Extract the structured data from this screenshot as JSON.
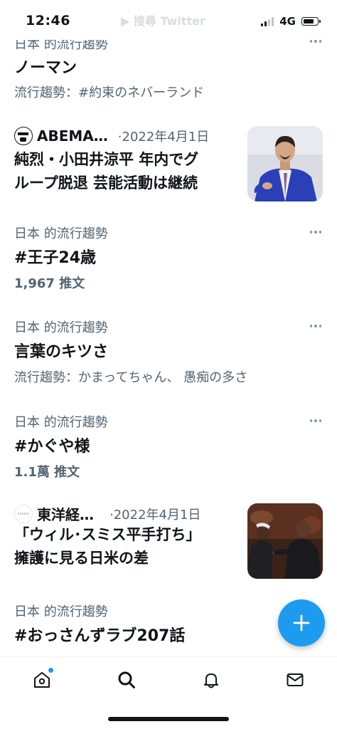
{
  "status_bar": {
    "time": "12:46",
    "network": "4G",
    "ghost_text": "▶ 搜尋 Twitter"
  },
  "feed": {
    "partial_trend": {
      "context": "日本 的流行趨勢",
      "headline": "ノーマン",
      "meta": "流行趨勢：#約束のネバーランド"
    },
    "news_1": {
      "source": "ABEMA…",
      "date": "·2022年4月1日",
      "title_lines": [
        "純烈・小田井涼平 年内でグ",
        "ループ脱退 芸能活動は継続"
      ],
      "thumbnail": "man-in-blue-suit-photo"
    },
    "trend_1": {
      "context": "日本 的流行趨勢",
      "headline": "#王子24歳",
      "meta": "1,967 推文"
    },
    "trend_2": {
      "context": "日本 的流行趨勢",
      "headline": "言葉のキツさ",
      "meta": "流行趨勢：かまってちゃん、 愚痴の多さ"
    },
    "trend_3": {
      "context": "日本 的流行趨勢",
      "headline": "#かぐや様",
      "meta": "1.1萬 推文"
    },
    "news_2": {
      "source": "東洋経…",
      "date": "·2022年4月1日",
      "title_lines": [
        "「ウィル･スミス平手打ち」",
        "擁護に見る日米の差"
      ],
      "thumbnail": "award-show-slap-photo"
    },
    "trend_4": {
      "context": "日本 的流行趨勢",
      "headline": "#おっさんずラブ207話"
    }
  },
  "fab": {
    "icon": "plus-icon",
    "color": "#1d9bf0"
  },
  "tab_bar": {
    "tabs": [
      {
        "icon": "home-icon",
        "has_badge": true
      },
      {
        "icon": "search-icon",
        "active": true
      },
      {
        "icon": "bell-icon"
      },
      {
        "icon": "mail-icon"
      }
    ]
  },
  "colors": {
    "text_primary": "#0f1419",
    "text_secondary": "#536471",
    "accent": "#1d9bf0"
  }
}
